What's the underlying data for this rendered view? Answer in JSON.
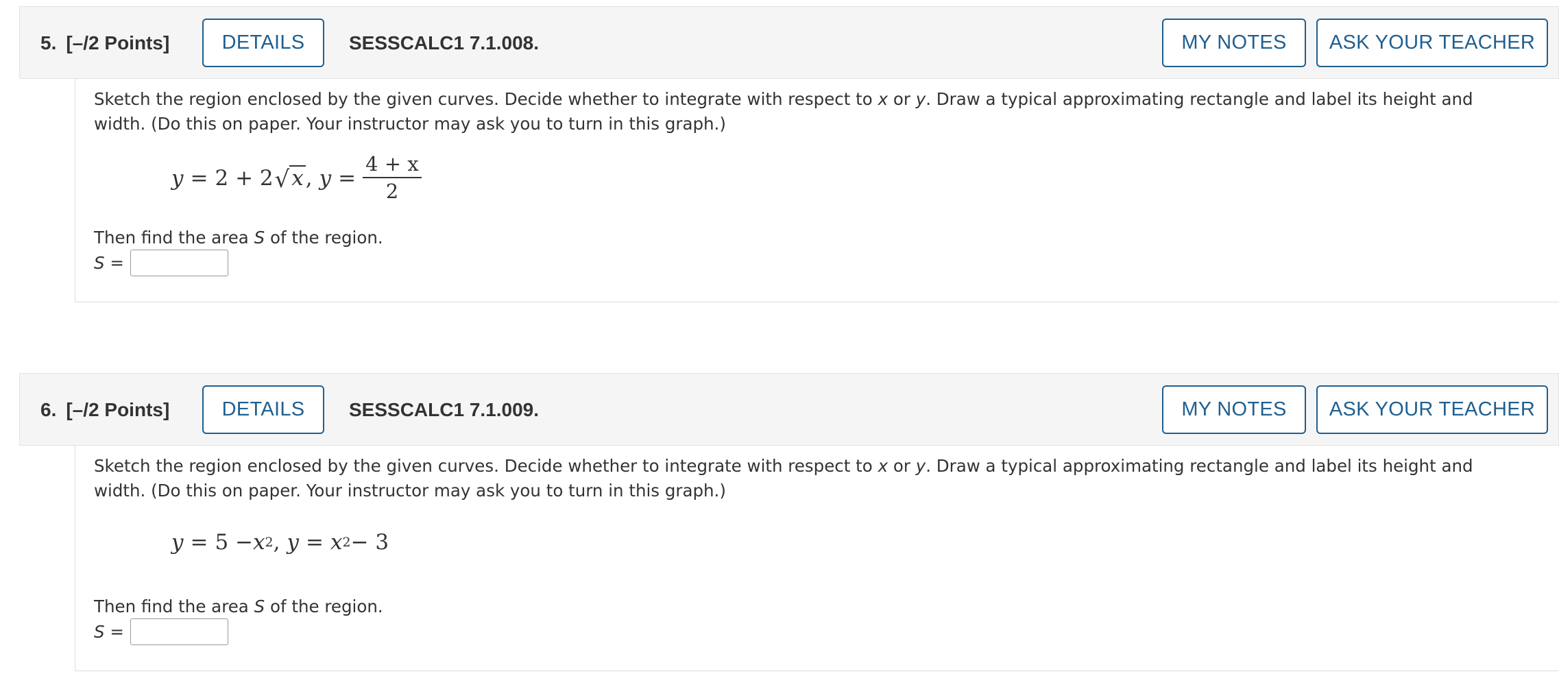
{
  "questions": [
    {
      "number": "5.",
      "points": "[–/2 Points]",
      "details_label": "DETAILS",
      "code": "SESSCALC1 7.1.008.",
      "my_notes_label": "MY NOTES",
      "ask_teacher_label": "ASK YOUR TEACHER",
      "prompt_parts": [
        "Sketch the region enclosed by the given curves. Decide whether to integrate with respect to ",
        "x",
        " or ",
        "y",
        ". Draw a typical approximating rectangle and label its height and width. (Do this on paper. Your instructor may ask you to turn in this graph.)"
      ],
      "equation": {
        "y1": "y",
        "eq1": "=",
        "rhs1": "2 + 2",
        "radicand": "x",
        "sep": ",",
        "y2": "y",
        "eq2": "=",
        "frac_num": "4 + x",
        "frac_den": "2"
      },
      "area_parts": [
        "Then find the area ",
        "S",
        " of the region."
      ],
      "answer_label_var": "S",
      "answer_label_eq": " =",
      "answer_value": ""
    },
    {
      "number": "6.",
      "points": "[–/2 Points]",
      "details_label": "DETAILS",
      "code": "SESSCALC1 7.1.009.",
      "my_notes_label": "MY NOTES",
      "ask_teacher_label": "ASK YOUR TEACHER",
      "prompt_parts": [
        "Sketch the region enclosed by the given curves. Decide whether to integrate with respect to ",
        "x",
        " or ",
        "y",
        ". Draw a typical approximating rectangle and label its height and width. (Do this on paper. Your instructor may ask you to turn in this graph.)"
      ],
      "equation": {
        "y1": "y",
        "eq1": "=",
        "rhs1a": "5 − ",
        "rhs1b": "x",
        "exp1": "2",
        "sep": ",",
        "y2": "y",
        "eq2": "=",
        "rhs2a": "x",
        "exp2": "2",
        "rhs2b": " − 3"
      },
      "area_parts": [
        "Then find the area ",
        "S",
        " of the region."
      ],
      "answer_label_var": "S",
      "answer_label_eq": " =",
      "answer_value": ""
    }
  ],
  "colors": {
    "accent": "#1f5f8f",
    "header_bg": "#f5f5f5",
    "text": "#333333"
  }
}
